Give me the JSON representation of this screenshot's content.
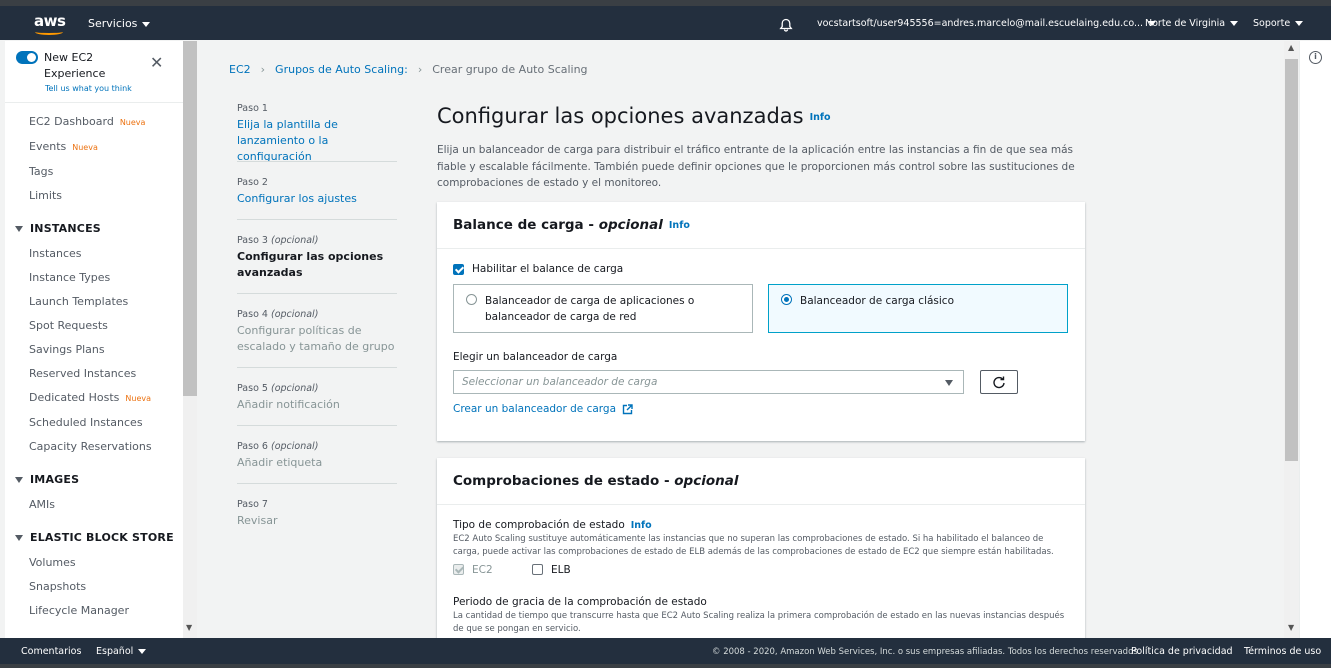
{
  "topbar": {
    "logo": "aws",
    "services": "Servicios",
    "user": "vocstartsoft/user945556=andres.marcelo@mail.escuelaing.edu.co...",
    "region": "Norte de Virginia",
    "support": "Soporte"
  },
  "sidebar": {
    "new_exp_title": "New EC2 Experience",
    "new_exp_sub": "Tell us what you think",
    "top_items": [
      {
        "label": "EC2 Dashboard",
        "badge": "Nueva"
      },
      {
        "label": "Events",
        "badge": "Nueva"
      },
      {
        "label": "Tags",
        "badge": ""
      },
      {
        "label": "Limits",
        "badge": ""
      }
    ],
    "instances_head": "INSTANCES",
    "instances_items": [
      {
        "label": "Instances",
        "badge": ""
      },
      {
        "label": "Instance Types",
        "badge": ""
      },
      {
        "label": "Launch Templates",
        "badge": ""
      },
      {
        "label": "Spot Requests",
        "badge": ""
      },
      {
        "label": "Savings Plans",
        "badge": ""
      },
      {
        "label": "Reserved Instances",
        "badge": ""
      },
      {
        "label": "Dedicated Hosts",
        "badge": "Nueva"
      },
      {
        "label": "Scheduled Instances",
        "badge": ""
      },
      {
        "label": "Capacity Reservations",
        "badge": ""
      }
    ],
    "images_head": "IMAGES",
    "images_items": [
      {
        "label": "AMIs"
      }
    ],
    "ebs_head": "ELASTIC BLOCK STORE",
    "ebs_items": [
      {
        "label": "Volumes"
      },
      {
        "label": "Snapshots"
      },
      {
        "label": "Lifecycle Manager"
      }
    ]
  },
  "breadcrumb": {
    "items": [
      "EC2",
      "Grupos de Auto Scaling:",
      "Crear grupo de Auto Scaling"
    ]
  },
  "steps": [
    {
      "label": "Paso 1",
      "label_opt": "",
      "name": "Elija la plantilla de lanzamiento o la configuración",
      "state": "link"
    },
    {
      "label": "Paso 2",
      "label_opt": "",
      "name": "Configurar los ajustes",
      "state": "link"
    },
    {
      "label": "Paso 3 ",
      "label_opt": "(opcional)",
      "name": "Configurar las opciones avanzadas",
      "state": "current"
    },
    {
      "label": "Paso 4 ",
      "label_opt": "(opcional)",
      "name": "Configurar políticas de escalado y tamaño de grupo",
      "state": "disabled"
    },
    {
      "label": "Paso 5 ",
      "label_opt": "(opcional)",
      "name": "Añadir notificación",
      "state": "disabled"
    },
    {
      "label": "Paso 6 ",
      "label_opt": "(opcional)",
      "name": "Añadir etiqueta",
      "state": "disabled"
    },
    {
      "label": "Paso 7",
      "label_opt": "",
      "name": "Revisar",
      "state": "disabled"
    }
  ],
  "page": {
    "title": "Configurar las opciones avanzadas",
    "info": "Info",
    "description": "Elija un balanceador de carga para distribuir el tráfico entrante de la aplicación entre las instancias a fin de que sea más fiable y escalable fácilmente. También puede definir opciones que le proporcionen más control sobre las sustituciones de comprobaciones de estado y el monitoreo."
  },
  "lb_panel": {
    "title": "Balance de carga - ",
    "title_opt": "opcional",
    "info": "Info",
    "enable_label": "Habilitar el balance de carga",
    "enable_checked": true,
    "option_alb": "Balanceador de carga de aplicaciones o balanceador de carga de red",
    "option_clb": "Balanceador de carga clásico",
    "selected_option": "clb",
    "choose_label": "Elegir un balanceador de carga",
    "select_placeholder": "Seleccionar un balanceador de carga",
    "create_link": "Crear un balanceador de carga"
  },
  "hc_panel": {
    "title": "Comprobaciones de estado - ",
    "title_opt": "opcional",
    "type_label": "Tipo de comprobación de estado",
    "info": "Info",
    "type_desc": "EC2 Auto Scaling sustituye automáticamente las instancias que no superan las comprobaciones de estado. Si ha habilitado el balanceo de carga, puede activar las comprobaciones de estado de ELB además de las comprobaciones de estado de EC2 que siempre están habilitadas.",
    "ec2_label": "EC2",
    "elb_label": "ELB",
    "grace_label": "Periodo de gracia de la comprobación de estado",
    "grace_desc": "La cantidad de tiempo que transcurre hasta que EC2 Auto Scaling realiza la primera comprobación de estado en las nuevas instancias después de que se pongan en servicio."
  },
  "footer": {
    "feedback": "Comentarios",
    "language": "Español",
    "copyright": "© 2008 - 2020, Amazon Web Services, Inc. o sus empresas afiliadas. Todos los derechos reservados.",
    "privacy": "Política de privacidad",
    "terms": "Términos de uso"
  }
}
